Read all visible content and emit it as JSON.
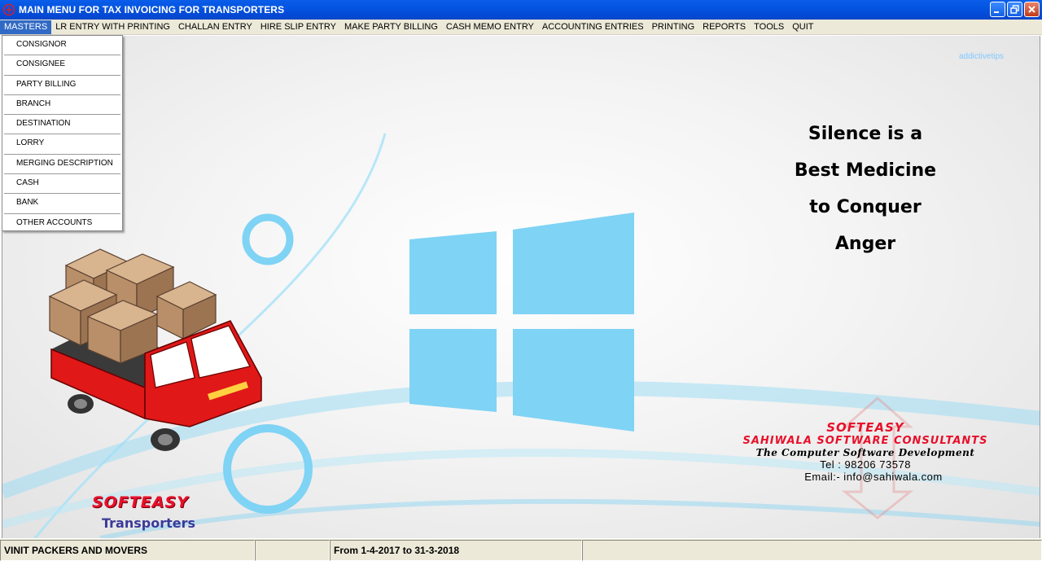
{
  "window": {
    "title": "MAIN MENU FOR TAX INVOICING FOR TRANSPORTERS",
    "icon": "app-logo-icon",
    "controls": [
      "minimize-icon",
      "restore-icon",
      "close-icon"
    ]
  },
  "menubar": {
    "items": [
      {
        "label": "MASTERS",
        "active": true
      },
      {
        "label": "LR ENTRY WITH PRINTING"
      },
      {
        "label": "CHALLAN ENTRY"
      },
      {
        "label": "HIRE SLIP ENTRY"
      },
      {
        "label": "MAKE PARTY BILLING"
      },
      {
        "label": "CASH MEMO ENTRY"
      },
      {
        "label": "ACCOUNTING ENTRIES"
      },
      {
        "label": "PRINTING"
      },
      {
        "label": "REPORTS"
      },
      {
        "label": "TOOLS"
      },
      {
        "label": "QUIT"
      }
    ]
  },
  "dropdown": {
    "items": [
      {
        "label": "CONSIGNOR"
      },
      {
        "label": "CONSIGNEE"
      },
      {
        "label": "PARTY BILLING"
      },
      {
        "label": "BRANCH"
      },
      {
        "label": "DESTINATION"
      },
      {
        "label": "LORRY"
      },
      {
        "label": "MERGING DESCRIPTION"
      },
      {
        "label": "CASH"
      },
      {
        "label": "BANK"
      },
      {
        "label": "OTHER ACCOUNTS"
      }
    ]
  },
  "background": {
    "watermark": "addictivetips",
    "quote_lines": [
      "Silence is a",
      "Best Medicine",
      "to Conquer",
      "Anger"
    ],
    "accent_color": "#7fd3f5"
  },
  "company": {
    "brand": "SOFTEASY",
    "name": "SAHIWALA SOFTWARE CONSULTANTS",
    "tagline": "The Computer Software Development",
    "tel": "Tel : 98206 73578",
    "email": "Email:- info@sahiwala.com"
  },
  "logo": {
    "brand": "SOFTEASY",
    "product": "Transporters"
  },
  "statusbar": {
    "company": "VINIT PACKERS AND MOVERS",
    "blank": "",
    "period": "From 1-4-2017 to 31-3-2018"
  }
}
